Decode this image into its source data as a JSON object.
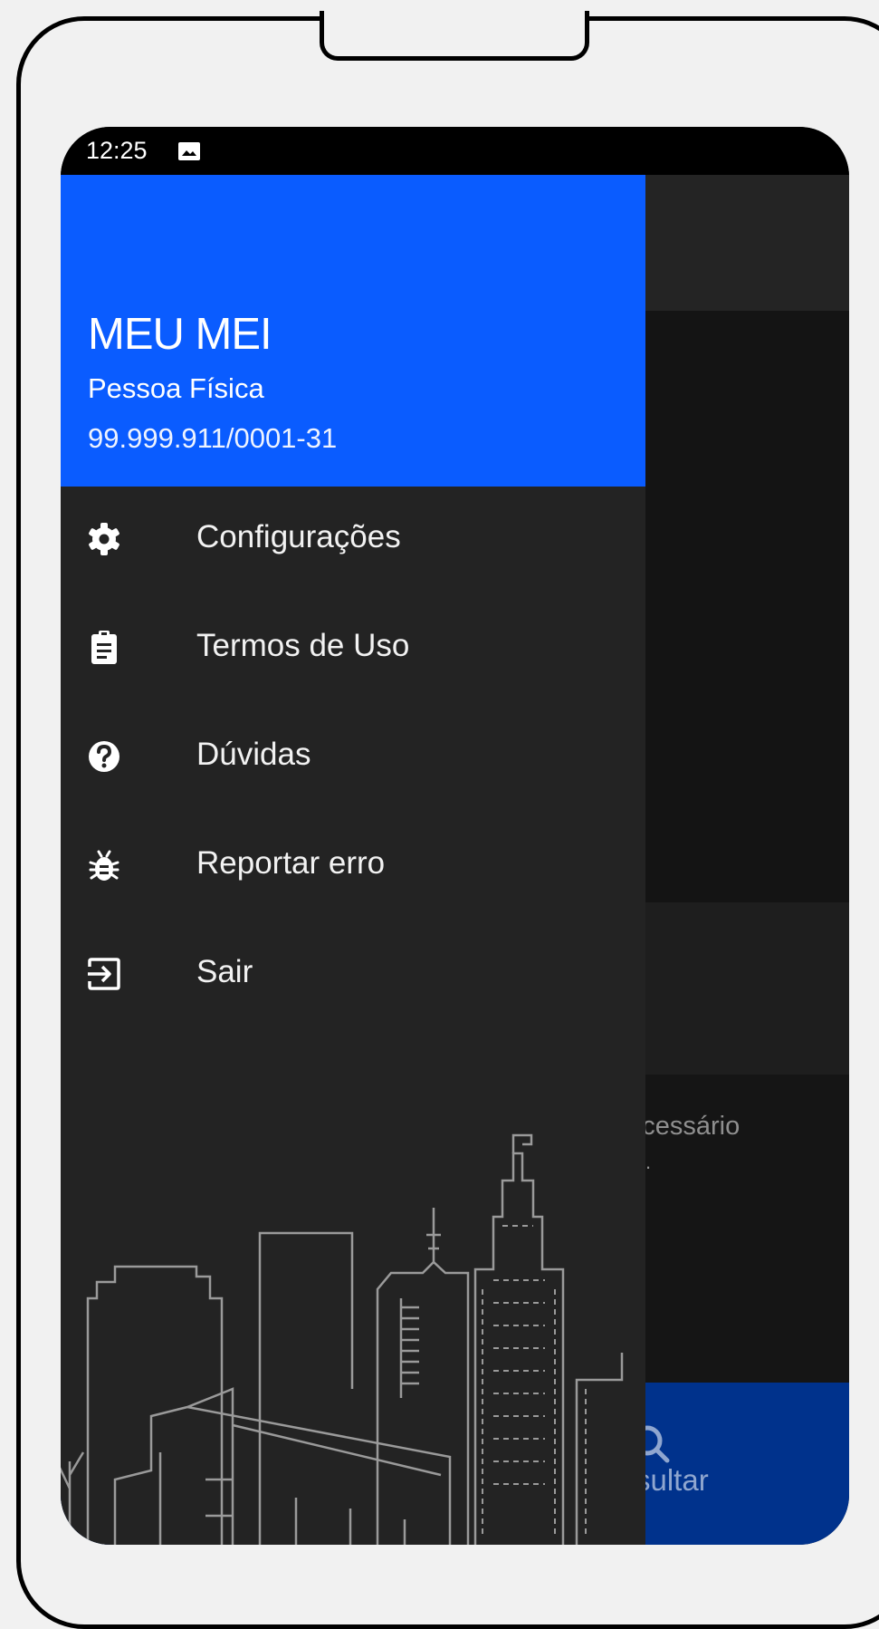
{
  "statusbar": {
    "time": "12:25"
  },
  "drawer": {
    "title": "MEU MEI",
    "subtitle": "Pessoa Física",
    "cnpj": "99.999.911/0001-31",
    "items": [
      {
        "label": "Configurações",
        "icon": "gear-icon"
      },
      {
        "label": "Termos de Uso",
        "icon": "clipboard-icon"
      },
      {
        "label": "Dúvidas",
        "icon": "help-circle-icon"
      },
      {
        "label": "Reportar erro",
        "icon": "bug-icon"
      },
      {
        "label": "Sair",
        "icon": "logout-icon"
      }
    ]
  },
  "background": {
    "partial_text": "necessário",
    "partial_dot": ".",
    "bottom_nav_label": "sultar"
  },
  "colors": {
    "header_blue": "#0a5cff",
    "drawer_bg": "#232323",
    "bottom_nav_blue": "#00328c"
  }
}
